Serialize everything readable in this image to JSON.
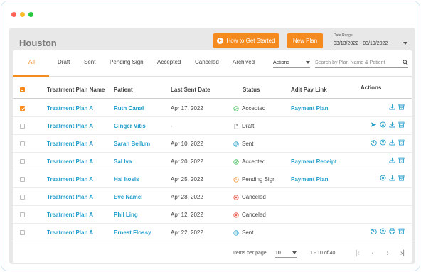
{
  "window": {
    "dot_colors": [
      "#ff5f57",
      "#febc2e",
      "#28c840"
    ]
  },
  "header": {
    "city": "Houston",
    "how_to_label": "How to Get Started",
    "new_plan_label": "New Plan",
    "date_range_label": "Date Range",
    "date_range_value": "03/13/2022 - 03/19/2022"
  },
  "tabs": [
    {
      "label": "All",
      "active": true
    },
    {
      "label": "Draft"
    },
    {
      "label": "Sent"
    },
    {
      "label": "Pending Sign"
    },
    {
      "label": "Accepted"
    },
    {
      "label": "Canceled"
    },
    {
      "label": "Archived"
    }
  ],
  "toolbar": {
    "actions_label": "Actions",
    "search_placeholder": "Search by Plan Name & Patient"
  },
  "table": {
    "headers": {
      "plan": "Treatment Plan Name",
      "patient": "Patient",
      "last_sent": "Last Sent Date",
      "status": "Status",
      "pay_link": "Adit Pay Link",
      "actions": "Actions"
    },
    "rows": [
      {
        "checked": true,
        "plan": "Treatment Plan A",
        "patient": "Ruth Canal",
        "date": "Apr 17, 2022",
        "status": "Accepted",
        "status_icon": "check-circle-icon",
        "pay_link": "Payment Plan",
        "actions": [
          "download-icon",
          "archive-icon"
        ]
      },
      {
        "checked": false,
        "plan": "Treatment Plan A",
        "patient": "Ginger Vitis",
        "date": "-",
        "status": "Draft",
        "status_icon": "document-icon",
        "pay_link": "",
        "actions": [
          "send-icon",
          "cancel-circle-icon",
          "download-icon",
          "archive-icon"
        ]
      },
      {
        "checked": false,
        "plan": "Treatment Plan A",
        "patient": "Sarah Bellum",
        "date": "Apr 10, 2022",
        "status": "Sent",
        "status_icon": "sent-circle-icon",
        "pay_link": "",
        "actions": [
          "history-icon",
          "cancel-circle-icon",
          "download-icon",
          "archive-icon"
        ]
      },
      {
        "checked": false,
        "plan": "Treatment Plan A",
        "patient": "Sal Iva",
        "date": "Apr 20, 2022",
        "status": "Accepted",
        "status_icon": "check-circle-icon",
        "pay_link": "Payment Receipt",
        "actions": [
          "download-icon",
          "archive-icon"
        ]
      },
      {
        "checked": false,
        "plan": "Treatment Plan A",
        "patient": "Hal Itosis",
        "date": "Apr 25, 2022",
        "status": "Pending Sign",
        "status_icon": "clock-circle-icon",
        "pay_link": "Payment Plan",
        "actions": [
          "cancel-circle-icon",
          "download-icon",
          "archive-icon"
        ]
      },
      {
        "checked": false,
        "plan": "Treatment Plan A",
        "patient": "Eve Namel",
        "date": "Apr 28, 2022",
        "status": "Canceled",
        "status_icon": "x-circle-icon",
        "pay_link": "",
        "actions": []
      },
      {
        "checked": false,
        "plan": "Treatment Plan A",
        "patient": "Phil Ling",
        "date": "Apr 12, 2022",
        "status": "Canceled",
        "status_icon": "x-circle-icon",
        "pay_link": "",
        "actions": []
      },
      {
        "checked": false,
        "plan": "Treatment Plan A",
        "patient": "Ernest Flossy",
        "date": "Apr 22, 2022",
        "status": "Sent",
        "status_icon": "sent-circle-icon",
        "pay_link": "",
        "actions": [
          "history-icon",
          "cancel-circle-icon",
          "print-icon",
          "archive-icon"
        ]
      }
    ]
  },
  "pagination": {
    "items_per_page_label": "Items per page:",
    "items_per_page_value": "10",
    "range_text": "1 - 10 of 40"
  },
  "colors": {
    "accent": "#f58a1f",
    "link": "#1e9cc9",
    "accepted": "#2db84c",
    "canceled": "#e5483c",
    "pending": "#f58a1f",
    "sent": "#1e9cc9",
    "draft": "#777777"
  }
}
